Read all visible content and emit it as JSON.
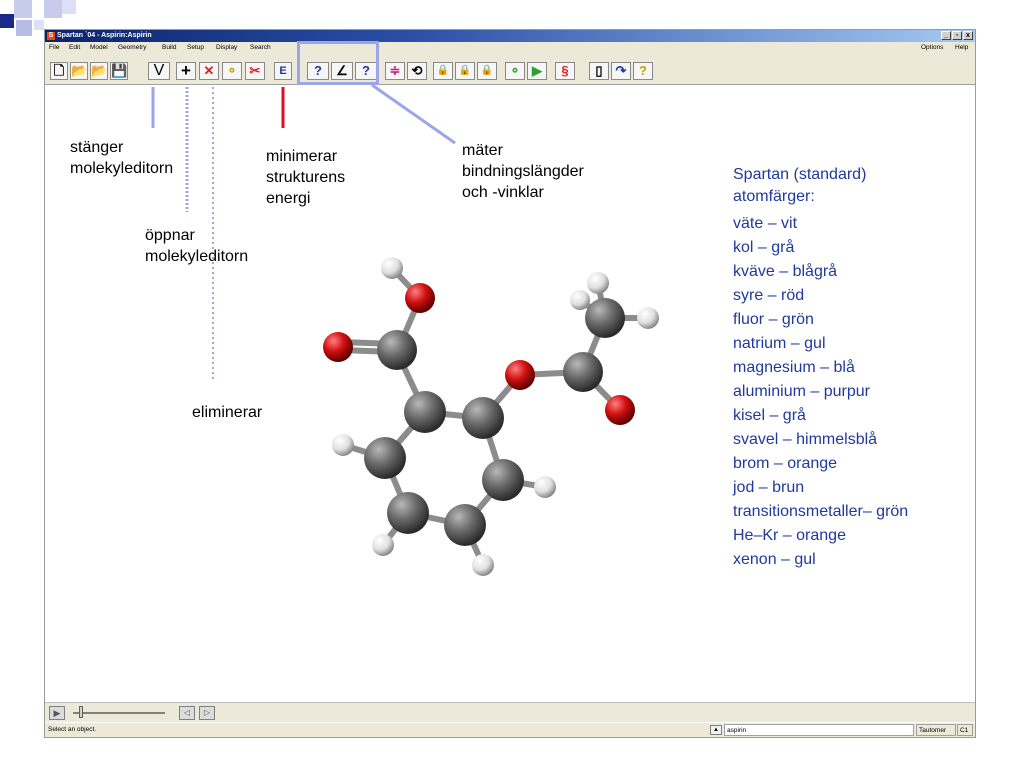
{
  "window": {
    "title": "Spartan `04 - Aspirin:Aspirin",
    "app_icon": "S",
    "minimize": "_",
    "restore": "▫",
    "close": "x"
  },
  "menu": {
    "left": [
      "File",
      "Edit",
      "Model",
      "Geometry",
      "Build",
      "Setup",
      "Display",
      "Search"
    ],
    "right": [
      "Options",
      "Help"
    ]
  },
  "toolbar": {
    "buttons": [
      {
        "name": "new-file-icon",
        "glyph": "🗋"
      },
      {
        "name": "open-folder-icon",
        "glyph": "📂"
      },
      {
        "name": "open-folder-2-icon",
        "glyph": "📂"
      },
      {
        "name": "save-icon",
        "glyph": "💾"
      },
      {
        "name": "view-icon",
        "glyph": "V"
      },
      {
        "name": "add-fragment-icon",
        "glyph": "+"
      },
      {
        "name": "delete-icon",
        "glyph": "✕"
      },
      {
        "name": "make-bond-icon",
        "glyph": "⚬"
      },
      {
        "name": "break-bond-icon",
        "glyph": "✂"
      },
      {
        "name": "minimize-energy-icon",
        "glyph": "E"
      },
      {
        "name": "measure-distance-icon",
        "glyph": "?"
      },
      {
        "name": "measure-angle-icon",
        "glyph": "∠"
      },
      {
        "name": "measure-dihedral-icon",
        "glyph": "?"
      },
      {
        "name": "freeze-icon",
        "glyph": "≑"
      },
      {
        "name": "rotate-icon",
        "glyph": "⟲"
      },
      {
        "name": "constrain-distance-icon",
        "glyph": "🔒"
      },
      {
        "name": "constrain-angle-icon",
        "glyph": "🔒"
      },
      {
        "name": "constrain-dihedral-icon",
        "glyph": "🔒"
      },
      {
        "name": "define-point-icon",
        "glyph": "⚬"
      },
      {
        "name": "define-plane-icon",
        "glyph": "▶"
      },
      {
        "name": "heat-icon",
        "glyph": "§"
      },
      {
        "name": "surface-icon",
        "glyph": "▯"
      },
      {
        "name": "reaction-icon",
        "glyph": "↷"
      },
      {
        "name": "query-icon",
        "glyph": "?"
      }
    ]
  },
  "annotations": {
    "stanger": "stänger\nmolekyleditorn",
    "oppnar": "öppnar\nmolekyleditorn",
    "eliminerar": "eliminerar",
    "minimerar": "minimerar\nstrukturens\nenergi",
    "mater": "mäter\nbindningslängder\noch -vinklar"
  },
  "legend": {
    "title": "Spartan (standard)\natomfärger:",
    "items": [
      "väte – vit",
      "kol – grå",
      "kväve – blågrå",
      "syre – röd",
      "fluor – grön",
      "natrium – gul",
      "magnesium – blå",
      "aluminium – purpur",
      "kisel – grå",
      "svavel – himmelsblå",
      "brom – orange",
      "jod – brun",
      "transitionsmetaller– grön",
      "He–Kr – orange",
      "xenon – gul"
    ]
  },
  "status": {
    "message": "Select an object.",
    "molecule_name": "aspirin",
    "tautomer": "Tautomer",
    "symmetry": "C1"
  },
  "colors": {
    "legend_text": "#1f3a9f",
    "carbon": "#6a6a6a",
    "oxygen": "#d01010",
    "hydrogen": "#e8e8e8",
    "red_line": "#e01020",
    "blue_line": "#9aa6e8"
  }
}
